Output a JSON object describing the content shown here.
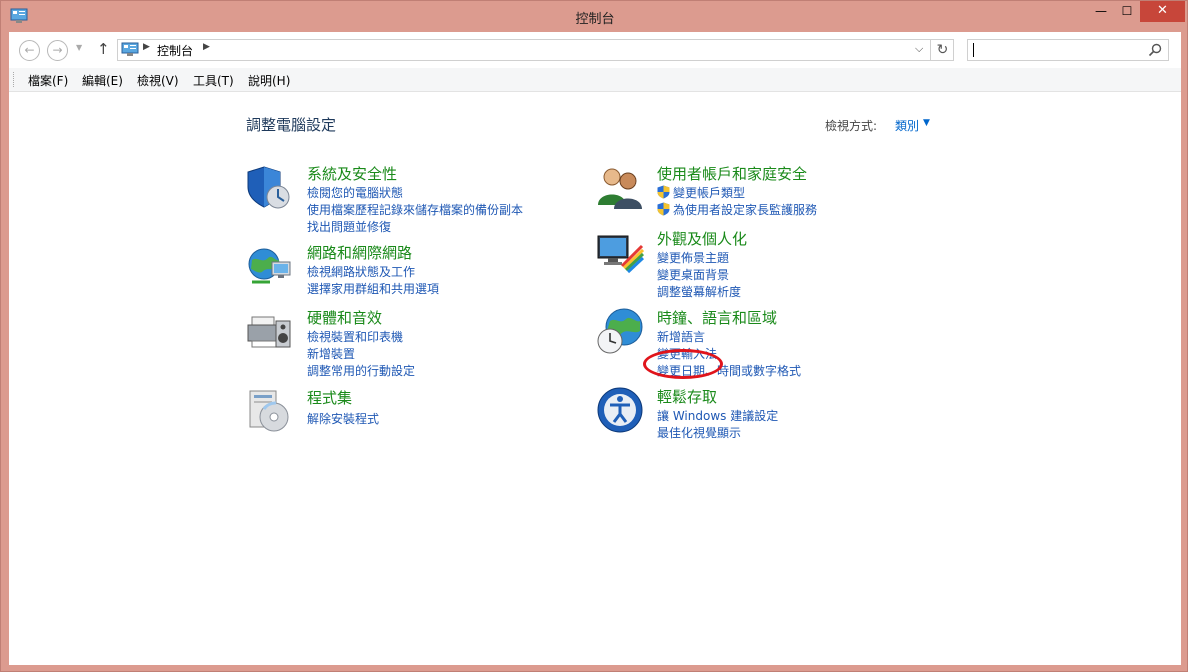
{
  "window": {
    "title": "控制台",
    "controls": {
      "minimize": "—",
      "maximize": "☐",
      "close": "✕"
    }
  },
  "navigation": {
    "back": "←",
    "forward": "→",
    "up": "↑",
    "address": "控制台",
    "search_placeholder": ""
  },
  "menu": [
    "檔案(F)",
    "編輯(E)",
    "檢視(V)",
    "工具(T)",
    "說明(H)"
  ],
  "main": {
    "title": "調整電腦設定",
    "view_by_label": "檢視方式:",
    "view_by_value": "類別"
  },
  "categories": [
    {
      "title": "系統及安全性",
      "icon": "shield-icon",
      "links": [
        "檢閱您的電腦狀態",
        "使用檔案歷程記錄來儲存檔案的備份副本",
        "找出問題並修復"
      ]
    },
    {
      "title": "網路和網際網路",
      "icon": "network-globe-icon",
      "links": [
        "檢視網路狀態及工作",
        "選擇家用群組和共用選項"
      ]
    },
    {
      "title": "硬體和音效",
      "icon": "printer-speaker-icon",
      "links": [
        "檢視裝置和印表機",
        "新增裝置",
        "調整常用的行動設定"
      ]
    },
    {
      "title": "程式集",
      "icon": "programs-disc-icon",
      "links": [
        "解除安裝程式"
      ]
    },
    {
      "title": "使用者帳戶和家庭安全",
      "icon": "users-icon",
      "links": [
        "變更帳戶類型",
        "為使用者設定家長監護服務"
      ]
    },
    {
      "title": "外觀及個人化",
      "icon": "monitor-color-icon",
      "links": [
        "變更佈景主題",
        "變更桌面背景",
        "調整螢幕解析度"
      ]
    },
    {
      "title": "時鐘、語言和區域",
      "icon": "clock-globe-icon",
      "links": [
        "新增語言",
        "變更輸入法",
        "變更日期、時間或數字格式"
      ]
    },
    {
      "title": "輕鬆存取",
      "icon": "ease-of-access-icon",
      "links": [
        "讓 Windows 建議設定",
        "最佳化視覺顯示"
      ]
    }
  ],
  "colors": {
    "window_frame": "#dc9b8f",
    "category_title": "#1a8a1a",
    "link": "#1f58b4",
    "annotation": "#e0141b"
  }
}
